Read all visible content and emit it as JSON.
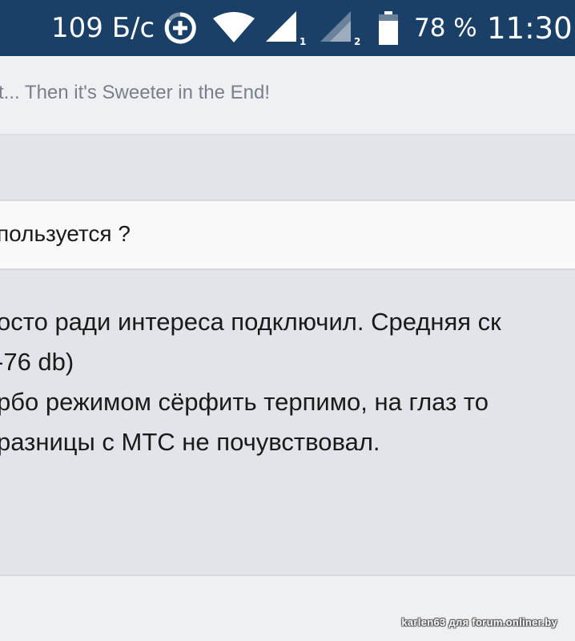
{
  "status_bar": {
    "net_speed": "109 Б/с",
    "sim1_index": "1",
    "sim2_index": "2",
    "battery_percent": "78 %",
    "battery_level": 0.78,
    "time": "11:30",
    "icons": [
      "data-saver-icon",
      "wifi-icon",
      "signal-sim1-icon",
      "signal-sim2-icon",
      "battery-icon"
    ]
  },
  "topic": {
    "subtitle": "t... Then it's Sweeter in the End!"
  },
  "question": {
    "text": "пользуется ?"
  },
  "post": {
    "lines": [
      "осто ради интереса подключил. Средняя ск",
      "-76 db)",
      "рбо режимом сёрфить терпимо, на глаз то",
      "разницы с МТС не почувствовал."
    ]
  },
  "watermark": "karlen63 для forum.onliner.by",
  "colors": {
    "status_bar_bg": "#1b4068",
    "page_bg": "#eef0f3",
    "post_bg": "#e1e4e8",
    "question_bg": "#f9f9fa"
  }
}
